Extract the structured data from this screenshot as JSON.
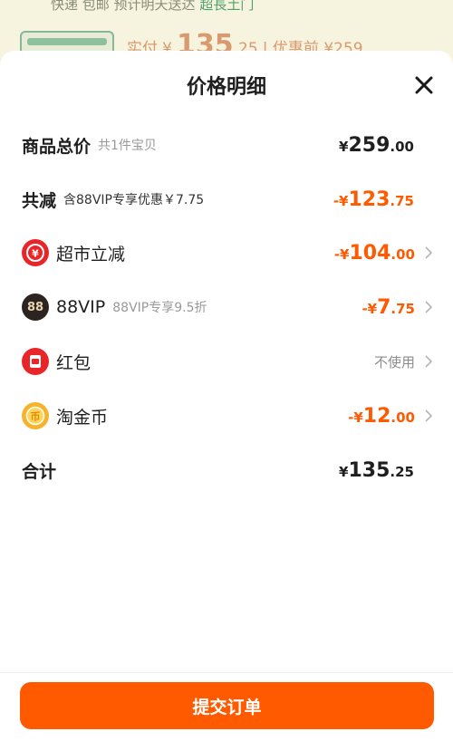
{
  "background": {
    "line1_text": "快递 包邮 预计明天送达 ",
    "line1_link": "超長土门",
    "price_label": "实付",
    "price_currency": "¥",
    "price_int": "135",
    "price_dec": ".25",
    "orig_label": "| 优惠前 ¥259"
  },
  "sheet": {
    "title": "价格明细",
    "rows": {
      "total": {
        "label": "商品总价",
        "sub": "共1件宝贝",
        "currency": "¥",
        "int": "259",
        "dec": ".00"
      },
      "discount": {
        "label": "共减",
        "sub": "含88VIP专享优惠￥7.75",
        "currency": "-¥",
        "int": "123",
        "dec": ".75"
      },
      "supermarket": {
        "label": "超市立减",
        "currency": "-¥",
        "int": "104",
        "dec": ".00"
      },
      "vip": {
        "icon_text": "88",
        "label": "88VIP",
        "sub": "88VIP专享9.5折",
        "currency": "-¥",
        "int": "7",
        "dec": ".75"
      },
      "redpacket": {
        "label": "红包",
        "value": "不使用"
      },
      "coins": {
        "label": "淘金币",
        "currency": "-¥",
        "int": "12",
        "dec": ".00"
      },
      "sum": {
        "label": "合计",
        "currency": "¥",
        "int": "135",
        "dec": ".25"
      }
    },
    "submit_label": "提交订单"
  },
  "colors": {
    "accent": "#ff5a00",
    "text": "#1f1f1f",
    "muted": "#999999"
  },
  "icons": [
    "close-icon",
    "supermarket-discount-icon",
    "vip-88-icon",
    "red-packet-icon",
    "taobao-coin-icon",
    "chevron-right-icon"
  ]
}
